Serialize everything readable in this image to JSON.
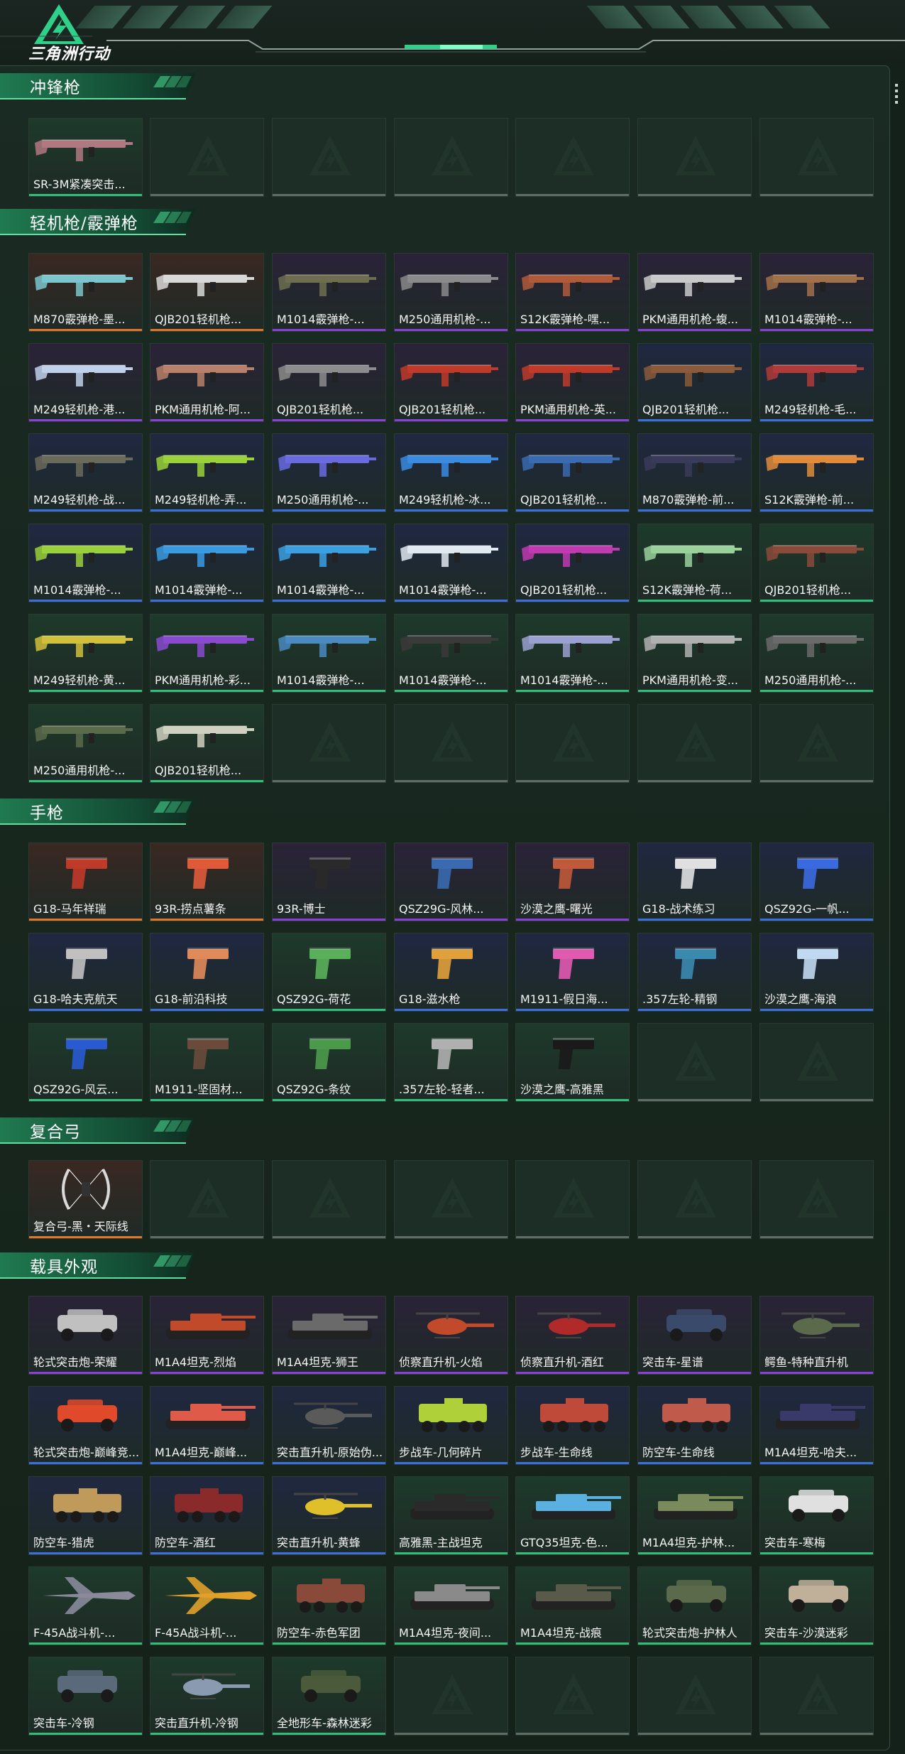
{
  "header": {
    "title": "三角洲行动"
  },
  "rarity_colors": {
    "orange": {
      "bg": "#3a2822",
      "line": "#e0762a"
    },
    "purple": {
      "bg": "#2a2238",
      "line": "#8a3fd9"
    },
    "blue": {
      "bg": "#1f2840",
      "line": "#3a6fe0"
    },
    "green": {
      "bg": "#1d3a2a",
      "line": "#2fbf76"
    }
  },
  "sections": [
    {
      "title": "冲锋枪",
      "items": [
        {
          "label": "SR-3M紧凑突击...",
          "rarity": "green",
          "kind": "gun",
          "color": "#b07880"
        },
        {
          "empty": true
        },
        {
          "empty": true
        },
        {
          "empty": true
        },
        {
          "empty": true
        },
        {
          "empty": true
        },
        {
          "empty": true
        }
      ]
    },
    {
      "title": "轻机枪/霰弹枪",
      "items": [
        {
          "label": "M870霰弹枪-墨...",
          "rarity": "orange",
          "kind": "gun",
          "color": "#7ac6cc"
        },
        {
          "label": "QJB201轻机枪...",
          "rarity": "orange",
          "kind": "gun",
          "color": "#d8d8d8"
        },
        {
          "label": "M1014霰弹枪-...",
          "rarity": "purple",
          "kind": "gun",
          "color": "#6d6e50"
        },
        {
          "label": "M250通用机枪-...",
          "rarity": "purple",
          "kind": "gun",
          "color": "#8a8a8a"
        },
        {
          "label": "S12K霰弹枪-嘿...",
          "rarity": "purple",
          "kind": "gun",
          "color": "#b05a3a"
        },
        {
          "label": "PKM通用机枪-蝮...",
          "rarity": "purple",
          "kind": "gun",
          "color": "#c9c9c9"
        },
        {
          "label": "M1014霰弹枪-...",
          "rarity": "purple",
          "kind": "gun",
          "color": "#a0704a"
        },
        {
          "label": "M249轻机枪-港...",
          "rarity": "purple",
          "kind": "gun",
          "color": "#bfd0ea"
        },
        {
          "label": "PKM通用机枪-阿...",
          "rarity": "purple",
          "kind": "gun",
          "color": "#b8806a"
        },
        {
          "label": "QJB201轻机枪...",
          "rarity": "purple",
          "kind": "gun",
          "color": "#8c8c8c"
        },
        {
          "label": "QJB201轻机枪...",
          "rarity": "purple",
          "kind": "gun",
          "color": "#c03a2a"
        },
        {
          "label": "PKM通用机枪-英...",
          "rarity": "purple",
          "kind": "gun",
          "color": "#c03a2a"
        },
        {
          "label": "QJB201轻机枪...",
          "rarity": "blue",
          "kind": "gun",
          "color": "#8a5a3a"
        },
        {
          "label": "M249轻机枪-毛...",
          "rarity": "blue",
          "kind": "gun",
          "color": "#b03a3a"
        },
        {
          "label": "M249轻机枪-战...",
          "rarity": "blue",
          "kind": "gun",
          "color": "#6a6a5a"
        },
        {
          "label": "M249轻机枪-弄...",
          "rarity": "blue",
          "kind": "gun",
          "color": "#9ad03a"
        },
        {
          "label": "M250通用机枪-...",
          "rarity": "blue",
          "kind": "gun",
          "color": "#6a6ae0"
        },
        {
          "label": "M249轻机枪-冰...",
          "rarity": "blue",
          "kind": "gun",
          "color": "#3a8ae0"
        },
        {
          "label": "QJB201轻机枪...",
          "rarity": "blue",
          "kind": "gun",
          "color": "#3a6ab0"
        },
        {
          "label": "M870霰弹枪-前...",
          "rarity": "blue",
          "kind": "gun",
          "color": "#3a3a5a"
        },
        {
          "label": "S12K霰弹枪-前...",
          "rarity": "blue",
          "kind": "gun",
          "color": "#e08a3a"
        },
        {
          "label": "M1014霰弹枪-...",
          "rarity": "blue",
          "kind": "gun",
          "color": "#9ad03a"
        },
        {
          "label": "M1014霰弹枪-...",
          "rarity": "blue",
          "kind": "gun",
          "color": "#3a9ae0"
        },
        {
          "label": "M1014霰弹枪-...",
          "rarity": "blue",
          "kind": "gun",
          "color": "#3aa0e0"
        },
        {
          "label": "M1014霰弹枪-...",
          "rarity": "blue",
          "kind": "gun",
          "color": "#e0e8f0"
        },
        {
          "label": "QJB201轻机枪...",
          "rarity": "blue",
          "kind": "gun",
          "color": "#c03ab0"
        },
        {
          "label": "S12K霰弹枪-荷...",
          "rarity": "green",
          "kind": "gun",
          "color": "#9ad09a"
        },
        {
          "label": "QJB201轻机枪...",
          "rarity": "green",
          "kind": "gun",
          "color": "#8a4a3a"
        },
        {
          "label": "M249轻机枪-黄...",
          "rarity": "green",
          "kind": "gun",
          "color": "#d0c03a"
        },
        {
          "label": "PKM通用机枪-彩...",
          "rarity": "green",
          "kind": "gun",
          "color": "#8a4ad0"
        },
        {
          "label": "M1014霰弹枪-...",
          "rarity": "green",
          "kind": "gun",
          "color": "#4a8ac0"
        },
        {
          "label": "M1014霰弹枪-...",
          "rarity": "green",
          "kind": "gun",
          "color": "#3a3a3a"
        },
        {
          "label": "M1014霰弹枪-...",
          "rarity": "green",
          "kind": "gun",
          "color": "#9aa0d0"
        },
        {
          "label": "PKM通用机枪-变...",
          "rarity": "green",
          "kind": "gun",
          "color": "#b0b0b0"
        },
        {
          "label": "M250通用机枪-...",
          "rarity": "green",
          "kind": "gun",
          "color": "#6a6a6a"
        },
        {
          "label": "M250通用机枪-...",
          "rarity": "green",
          "kind": "gun",
          "color": "#5a6a4a"
        },
        {
          "label": "QJB201轻机枪...",
          "rarity": "green",
          "kind": "gun",
          "color": "#d0d0c0"
        },
        {
          "empty": true
        },
        {
          "empty": true
        },
        {
          "empty": true
        },
        {
          "empty": true
        },
        {
          "empty": true
        }
      ]
    },
    {
      "title": "手枪",
      "items": [
        {
          "label": "G18-马年祥瑞",
          "rarity": "orange",
          "kind": "pistol",
          "color": "#c03a2a"
        },
        {
          "label": "93R-捞点薯条",
          "rarity": "orange",
          "kind": "pistol",
          "color": "#e05a3a"
        },
        {
          "label": "93R-博士",
          "rarity": "purple",
          "kind": "pistol",
          "color": "#2a2a2a"
        },
        {
          "label": "QSZ29G-风林...",
          "rarity": "purple",
          "kind": "pistol",
          "color": "#3a6ab0"
        },
        {
          "label": "沙漠之鹰-曙光",
          "rarity": "purple",
          "kind": "pistol",
          "color": "#c05a3a"
        },
        {
          "label": "G18-战术练习",
          "rarity": "blue",
          "kind": "pistol",
          "color": "#e0e0e0"
        },
        {
          "label": "QSZ92G-一帆...",
          "rarity": "blue",
          "kind": "pistol",
          "color": "#3a6ae0"
        },
        {
          "label": "G18-哈夫克航天",
          "rarity": "blue",
          "kind": "pistol",
          "color": "#c0c0c0"
        },
        {
          "label": "G18-前沿科技",
          "rarity": "blue",
          "kind": "pistol",
          "color": "#e08a5a"
        },
        {
          "label": "QSZ92G-荷花",
          "rarity": "green",
          "kind": "pistol",
          "color": "#5ab05a"
        },
        {
          "label": "G18-滋水枪",
          "rarity": "blue",
          "kind": "pistol",
          "color": "#e0a03a"
        },
        {
          "label": "M1911-假日海...",
          "rarity": "blue",
          "kind": "pistol",
          "color": "#e05ab0"
        },
        {
          "label": ".357左轮-精钢",
          "rarity": "blue",
          "kind": "pistol",
          "color": "#3a8ab0"
        },
        {
          "label": "沙漠之鹰-海浪",
          "rarity": "blue",
          "kind": "pistol",
          "color": "#c0d8f0"
        },
        {
          "label": "QSZ92G-风云...",
          "rarity": "green",
          "kind": "pistol",
          "color": "#2a5ad0"
        },
        {
          "label": "M1911-坚固材...",
          "rarity": "green",
          "kind": "pistol",
          "color": "#6a4a3a"
        },
        {
          "label": "QSZ92G-条纹",
          "rarity": "green",
          "kind": "pistol",
          "color": "#4a9a4a"
        },
        {
          "label": ".357左轮-轻者...",
          "rarity": "green",
          "kind": "pistol",
          "color": "#b0b0b0"
        },
        {
          "label": "沙漠之鹰-高雅黑",
          "rarity": "green",
          "kind": "pistol",
          "color": "#1a1a1a"
        },
        {
          "empty": true
        },
        {
          "empty": true
        }
      ]
    },
    {
      "title": "复合弓",
      "items": [
        {
          "label": "复合弓-黑・天际线",
          "rarity": "orange",
          "kind": "bow",
          "color": "#d8d8d8"
        },
        {
          "empty": true
        },
        {
          "empty": true
        },
        {
          "empty": true
        },
        {
          "empty": true
        },
        {
          "empty": true
        },
        {
          "empty": true
        }
      ]
    },
    {
      "title": "载具外观",
      "items": [
        {
          "label": "轮式突击炮-荣耀",
          "rarity": "purple",
          "kind": "vehicle",
          "color": "#c0c0c0"
        },
        {
          "label": "M1A4坦克-烈焰",
          "rarity": "purple",
          "kind": "tank",
          "color": "#c04a2a"
        },
        {
          "label": "M1A4坦克-狮王",
          "rarity": "purple",
          "kind": "tank",
          "color": "#6a6a6a"
        },
        {
          "label": "侦察直升机-火焰",
          "rarity": "purple",
          "kind": "heli",
          "color": "#c04a2a"
        },
        {
          "label": "侦察直升机-酒红",
          "rarity": "purple",
          "kind": "heli",
          "color": "#b02a2a"
        },
        {
          "label": "突击车-星谱",
          "rarity": "purple",
          "kind": "vehicle",
          "color": "#3a4a6a"
        },
        {
          "label": "鳄鱼-特种直升机",
          "rarity": "purple",
          "kind": "heli",
          "color": "#5a6a4a"
        },
        {
          "label": "轮式突击炮-巅峰竞...",
          "rarity": "blue",
          "kind": "vehicle",
          "color": "#e04a2a"
        },
        {
          "label": "M1A4坦克-巅峰...",
          "rarity": "blue",
          "kind": "tank",
          "color": "#e05a4a"
        },
        {
          "label": "突击直升机-原始伪...",
          "rarity": "blue",
          "kind": "heli",
          "color": "#5a5a5a"
        },
        {
          "label": "步战车-几何碎片",
          "rarity": "blue",
          "kind": "apc",
          "color": "#b0d03a"
        },
        {
          "label": "步战车-生命线",
          "rarity": "blue",
          "kind": "apc",
          "color": "#c04a3a"
        },
        {
          "label": "防空车-生命线",
          "rarity": "blue",
          "kind": "apc",
          "color": "#c05a4a"
        },
        {
          "label": "M1A4坦克-哈夫...",
          "rarity": "blue",
          "kind": "tank",
          "color": "#3a3a6a"
        },
        {
          "label": "防空车-猎虎",
          "rarity": "blue",
          "kind": "apc",
          "color": "#c09a5a"
        },
        {
          "label": "防空车-酒红",
          "rarity": "blue",
          "kind": "apc",
          "color": "#8a2a2a"
        },
        {
          "label": "突击直升机-黄蜂",
          "rarity": "blue",
          "kind": "heli",
          "color": "#e0c02a"
        },
        {
          "label": "高雅黑-主战坦克",
          "rarity": "green",
          "kind": "tank",
          "color": "#2a2a2a"
        },
        {
          "label": "GTQ35坦克-色...",
          "rarity": "green",
          "kind": "tank",
          "color": "#5ab0e0"
        },
        {
          "label": "M1A4坦克-护林...",
          "rarity": "green",
          "kind": "tank",
          "color": "#7a8a5a"
        },
        {
          "label": "突击车-寒梅",
          "rarity": "green",
          "kind": "vehicle",
          "color": "#e0e0e0"
        },
        {
          "label": "F-45A战斗机-...",
          "rarity": "green",
          "kind": "jet",
          "color": "#8a8a9a"
        },
        {
          "label": "F-45A战斗机-...",
          "rarity": "green",
          "kind": "jet",
          "color": "#e0a02a"
        },
        {
          "label": "防空车-赤色军团",
          "rarity": "green",
          "kind": "apc",
          "color": "#8a4a3a"
        },
        {
          "label": "M1A4坦克-夜间...",
          "rarity": "green",
          "kind": "tank",
          "color": "#8a8a8a"
        },
        {
          "label": "M1A4坦克-战痕",
          "rarity": "green",
          "kind": "tank",
          "color": "#5a5a4a"
        },
        {
          "label": "轮式突击炮-护林人",
          "rarity": "green",
          "kind": "vehicle",
          "color": "#5a6a4a"
        },
        {
          "label": "突击车-沙漠迷彩",
          "rarity": "green",
          "kind": "vehicle",
          "color": "#c0b09a"
        },
        {
          "label": "突击车-冷钢",
          "rarity": "green",
          "kind": "vehicle",
          "color": "#5a6a7a"
        },
        {
          "label": "突击直升机-冷钢",
          "rarity": "green",
          "kind": "heli",
          "color": "#8a9ab0"
        },
        {
          "label": "全地形车-森林迷彩",
          "rarity": "green",
          "kind": "atv",
          "color": "#4a5a3a"
        },
        {
          "empty": true
        },
        {
          "empty": true
        },
        {
          "empty": true
        },
        {
          "empty": true
        }
      ]
    }
  ]
}
